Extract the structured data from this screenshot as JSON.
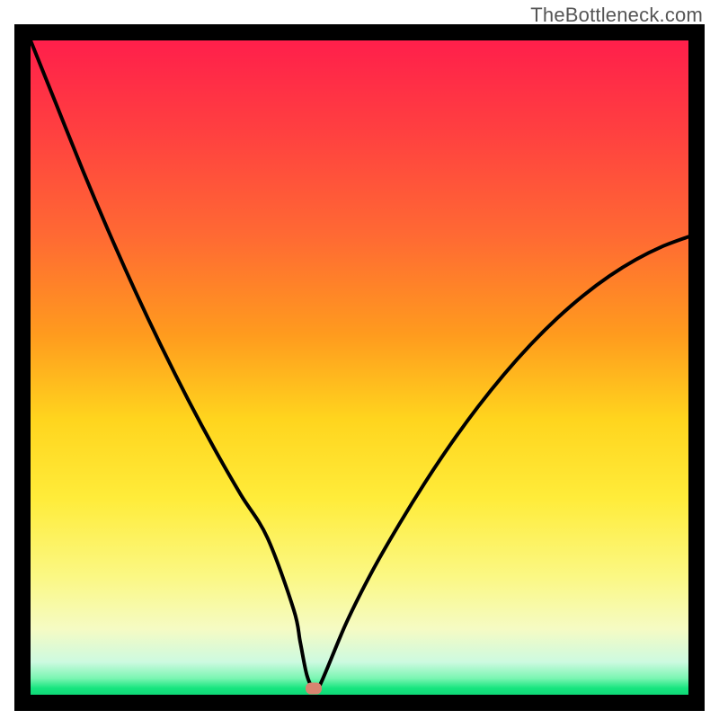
{
  "watermark": {
    "text": "TheBottleneck.com"
  },
  "chart_data": {
    "type": "line",
    "title": "",
    "xlabel": "",
    "ylabel": "",
    "xlim": [
      0,
      100
    ],
    "ylim": [
      0,
      100
    ],
    "grid": false,
    "axes_visible": false,
    "series": [
      {
        "name": "bottleneck-curve",
        "x": [
          0,
          4,
          8,
          12,
          16,
          20,
          24,
          28,
          32,
          36,
          40,
          41,
          42,
          43,
          44,
          48,
          52,
          56,
          60,
          64,
          68,
          72,
          76,
          80,
          84,
          88,
          92,
          96,
          100
        ],
        "y": [
          100,
          90,
          80,
          70.5,
          61.5,
          53,
          45,
          37.5,
          30.5,
          24,
          13,
          8,
          3,
          1,
          1.5,
          11,
          19,
          26,
          32.5,
          38.5,
          44,
          49,
          53.5,
          57.5,
          61,
          64,
          66.5,
          68.5,
          70
        ]
      }
    ],
    "min_point": {
      "x": 43,
      "y": 1
    },
    "marker": {
      "color": "#d88470",
      "shape": "rounded-rect"
    },
    "background_gradient": {
      "top": "#ff1f4b",
      "bottom": "#0fd877",
      "stops": [
        "#ff1f4b",
        "#ff4040",
        "#ff6a33",
        "#ff9b1e",
        "#ffd51e",
        "#ffec3a",
        "#fbf884",
        "#f5fbc4",
        "#cdfae0",
        "#7af5b2",
        "#17e57f",
        "#0fd877"
      ]
    }
  },
  "plot": {
    "inner_w": 732,
    "inner_h": 728
  }
}
